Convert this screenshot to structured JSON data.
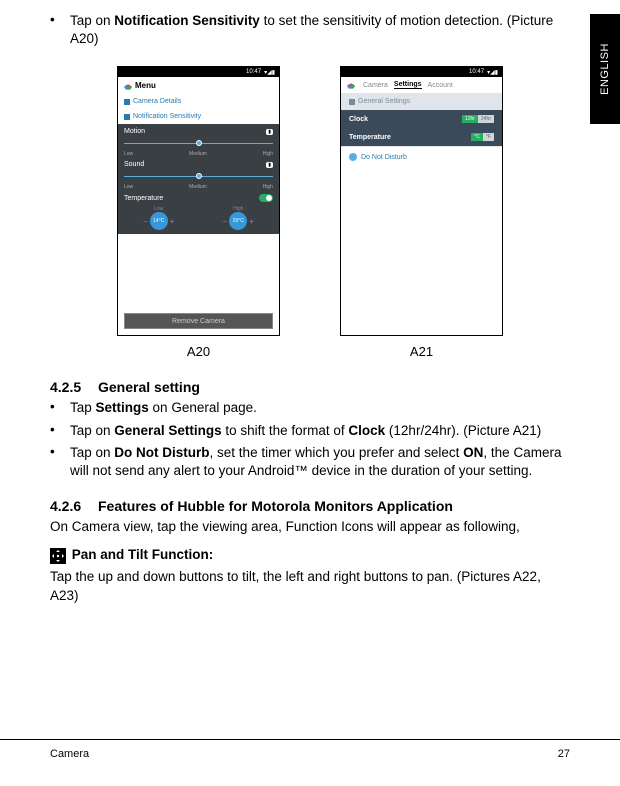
{
  "side_label": "ENGLISH",
  "intro": {
    "bullet": "•",
    "pre": "Tap on ",
    "bold": "Notification Sensitivity",
    "post": " to set the sensitivity of motion detection. (Picture A20)"
  },
  "phoneA": {
    "time": "10:47",
    "menu": "Menu",
    "camera_details": "Camera Details",
    "notif_sens": "Notification Sensitivity",
    "motion": "Motion",
    "sound": "Sound",
    "low": "Low",
    "medium": "Medium",
    "high": "High",
    "temperature": "Temperature",
    "t1": "14°C",
    "t2": "29°C",
    "remove": "Remove Camera"
  },
  "phoneB": {
    "time": "10:47",
    "tab1": "Camera",
    "tab2": "Settings",
    "tab3": "Account",
    "gs": "General Settings",
    "clock": "Clock",
    "c1": "12hr",
    "c2": "24hr",
    "temp": "Temperature",
    "u1": "°C",
    "u2": "°F",
    "dnd": "Do Not Disturb"
  },
  "capA": "A20",
  "capB": "A21",
  "s425": {
    "num": "4.2.5",
    "title": "General setting",
    "b1": {
      "pre": "Tap ",
      "bold": "Settings",
      "post": " on General page."
    },
    "b2": {
      "pre": "Tap on ",
      "bold": "General Settings",
      "mid": " to shift the format of ",
      "bold2": "Clock",
      "post": " (12hr/24hr). (Picture A21)"
    },
    "b3": {
      "pre": "Tap on ",
      "bold": "Do Not Disturb",
      "mid": ", set the timer which you prefer and select ",
      "bold2": "ON",
      "post": ", the Camera will not send any alert to your Android™ device in the duration of your setting."
    }
  },
  "s426": {
    "num": "4.2.6",
    "title": "Features of Hubble for Motorola Monitors Application",
    "intro": "On Camera view, tap the viewing area, Function Icons will appear as following,",
    "pan_title": "Pan and Tilt Function:",
    "pan_body": "Tap the up and down buttons to tilt, the left and right buttons to pan. (Pictures A22, A23)"
  },
  "footer": {
    "left": "Camera",
    "right": "27"
  }
}
